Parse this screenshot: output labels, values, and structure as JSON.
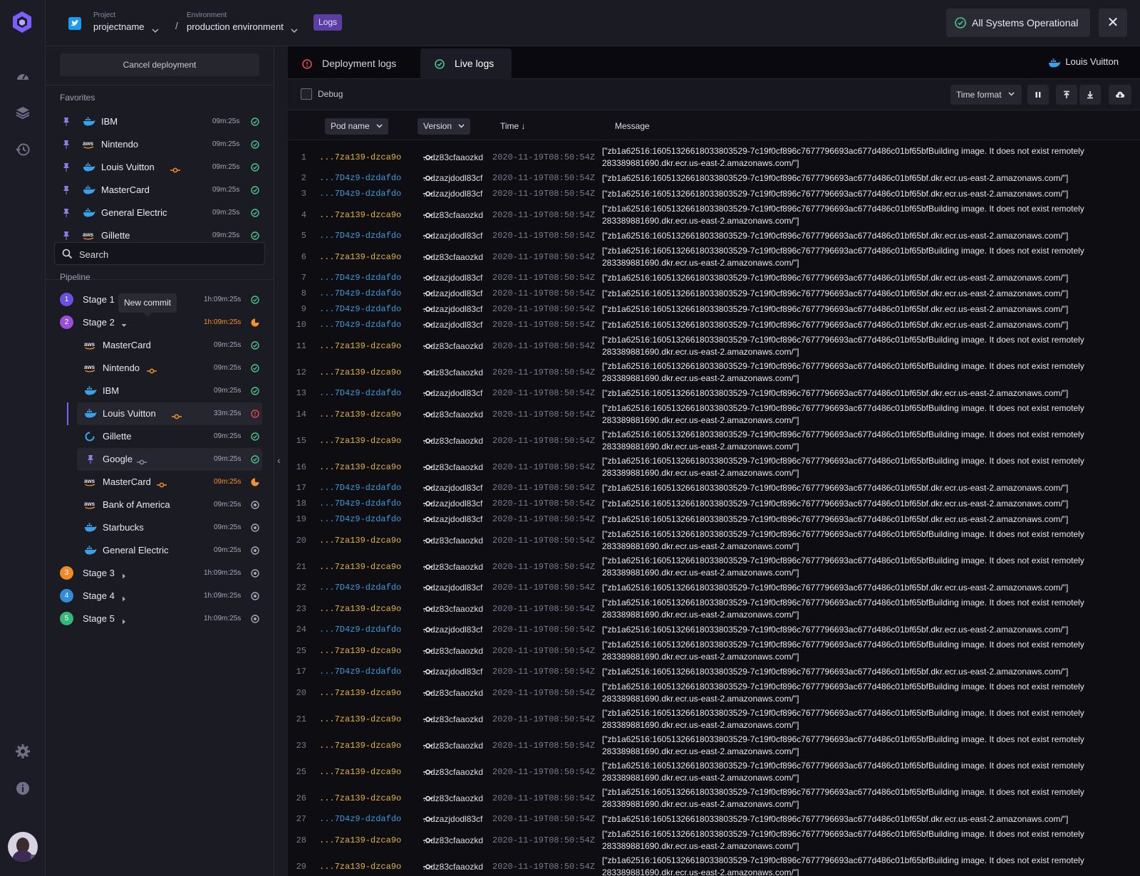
{
  "colors": {
    "accent": "#7d5fff",
    "success": "#4cc38a",
    "warning": "#f5902a",
    "error": "#e5484d",
    "pod_a": "#e3b341",
    "pod_b": "#3a9bd9"
  },
  "header": {
    "project_label": "Project",
    "project_name": "projectname",
    "env_label": "Environment",
    "env_name": "production environment",
    "separator": "/",
    "badge": "Logs",
    "status": "All Systems Operational",
    "close": "✕"
  },
  "sidebar": {
    "cancel": "Cancel deployment",
    "favorites_title": "Favorites",
    "favorites": [
      {
        "name": "IBM",
        "provider": "docker",
        "dur": "09m:25s",
        "status": "success",
        "commit": false
      },
      {
        "name": "Nintendo",
        "provider": "aws",
        "dur": "09m:25s",
        "status": "success",
        "commit": false
      },
      {
        "name": "Louis Vuitton",
        "provider": "docker",
        "dur": "09m:25s",
        "status": "success",
        "commit": true
      },
      {
        "name": "MasterCard",
        "provider": "docker",
        "dur": "09m:25s",
        "status": "success",
        "commit": false
      },
      {
        "name": "General Electric",
        "provider": "docker",
        "dur": "09m:25s",
        "status": "success",
        "commit": false
      },
      {
        "name": "Gillette",
        "provider": "aws",
        "dur": "09m:25s",
        "status": "success",
        "commit": false
      }
    ],
    "search_placeholder": "Search",
    "pipeline_title": "Pipeline",
    "tooltip": "New commit",
    "stages": [
      {
        "num": "1",
        "name": "Stage 1",
        "dur": "1h:09m:25s",
        "status": "success",
        "color": "#6b4fe0",
        "caret": "none"
      },
      {
        "num": "2",
        "name": "Stage 2",
        "dur": "1h:09m:25s",
        "status": "running",
        "color": "#9a4fd8",
        "caret": "down"
      },
      {
        "num": "3",
        "name": "Stage 3",
        "dur": "1h:09m:25s",
        "status": "pending",
        "color": "#f08a24",
        "caret": "right"
      },
      {
        "num": "4",
        "name": "Stage 4",
        "dur": "1h:09m:25s",
        "status": "pending",
        "color": "#2f8ed6",
        "caret": "right"
      },
      {
        "num": "5",
        "name": "Stage 5",
        "dur": "1h:09m:25s",
        "status": "pending",
        "color": "#36b87a",
        "caret": "right"
      }
    ],
    "stage2_items": [
      {
        "name": "MasterCard",
        "provider": "aws",
        "dur": "09m:25s",
        "status": "success",
        "commit": "none"
      },
      {
        "name": "Nintendo",
        "provider": "aws",
        "dur": "09m:25s",
        "status": "success",
        "commit": "orange"
      },
      {
        "name": "IBM",
        "provider": "docker",
        "dur": "09m:25s",
        "status": "success",
        "commit": "none"
      },
      {
        "name": "Louis Vuitton",
        "provider": "docker",
        "dur": "33m:25s",
        "status": "error",
        "commit": "orange"
      },
      {
        "name": "Gillette",
        "provider": "gitlab",
        "dur": "09m:25s",
        "status": "success",
        "commit": "none"
      },
      {
        "name": "Google",
        "provider": "pin",
        "dur": "09m:25s",
        "status": "success",
        "commit": "gray"
      },
      {
        "name": "MasterCard",
        "provider": "aws",
        "dur": "09m:25s",
        "status": "running",
        "commit": "orange"
      },
      {
        "name": "Bank of America",
        "provider": "aws",
        "dur": "09m:25s",
        "status": "pending",
        "commit": "none"
      },
      {
        "name": "Starbucks",
        "provider": "docker",
        "dur": "09m:25s",
        "status": "pending",
        "commit": "none"
      },
      {
        "name": "General Electric",
        "provider": "docker",
        "dur": "09m:25s",
        "status": "pending",
        "commit": "none"
      }
    ]
  },
  "main": {
    "tabs": [
      {
        "label": "Deployment logs",
        "status": "error"
      },
      {
        "label": "Live logs",
        "status": "success"
      }
    ],
    "app_name": "Louis Vuitton",
    "debug": "Debug",
    "time_format": "Time format",
    "columns": {
      "pod": "Pod name",
      "version": "Version",
      "time": "Time ↓",
      "message": "Message"
    },
    "pods": {
      "a": "...7za139-dzca9o",
      "b": "...7D4z9-dzdafdo"
    },
    "versions": {
      "a": "...dz83cfaaozkd",
      "b": "...dzazjdodl83cf"
    },
    "timestamp": "2020-11-19T08:50:54Z",
    "messages": {
      "long": "[\"zb1a62516:160513266180338035​29-7c19f0cf896c7677796693ac677d486c01bf65bfBuilding image. It does not exist remotely 283389881690.dkr.ecr.us-east-2.amazonaws.com/\"]",
      "short": "[\"zb1a62516:16051326618033803529-7c19f0cf896c7677796693ac677d486c01bf65bf.dkr.ecr.us-east-2.amazonaws.com/\"]"
    },
    "rows": [
      {
        "n": "1",
        "k": "a"
      },
      {
        "n": "2",
        "k": "b"
      },
      {
        "n": "3",
        "k": "b"
      },
      {
        "n": "4",
        "k": "a"
      },
      {
        "n": "5",
        "k": "b"
      },
      {
        "n": "6",
        "k": "a"
      },
      {
        "n": "7",
        "k": "b"
      },
      {
        "n": "8",
        "k": "b"
      },
      {
        "n": "9",
        "k": "b"
      },
      {
        "n": "10",
        "k": "b"
      },
      {
        "n": "11",
        "k": "a"
      },
      {
        "n": "12",
        "k": "a"
      },
      {
        "n": "13",
        "k": "b"
      },
      {
        "n": "14",
        "k": "a"
      },
      {
        "n": "15",
        "k": "a"
      },
      {
        "n": "16",
        "k": "a"
      },
      {
        "n": "17",
        "k": "b"
      },
      {
        "n": "18",
        "k": "b"
      },
      {
        "n": "19",
        "k": "b"
      },
      {
        "n": "20",
        "k": "a"
      },
      {
        "n": "21",
        "k": "a"
      },
      {
        "n": "22",
        "k": "b"
      },
      {
        "n": "23",
        "k": "a"
      },
      {
        "n": "24",
        "k": "b"
      },
      {
        "n": "25",
        "k": "a"
      },
      {
        "n": "17",
        "k": "b"
      },
      {
        "n": "20",
        "k": "a"
      },
      {
        "n": "21",
        "k": "a"
      },
      {
        "n": "23",
        "k": "a"
      },
      {
        "n": "25",
        "k": "a"
      },
      {
        "n": "26",
        "k": "a"
      },
      {
        "n": "27",
        "k": "b"
      },
      {
        "n": "28",
        "k": "a"
      },
      {
        "n": "29",
        "k": "a"
      }
    ]
  }
}
